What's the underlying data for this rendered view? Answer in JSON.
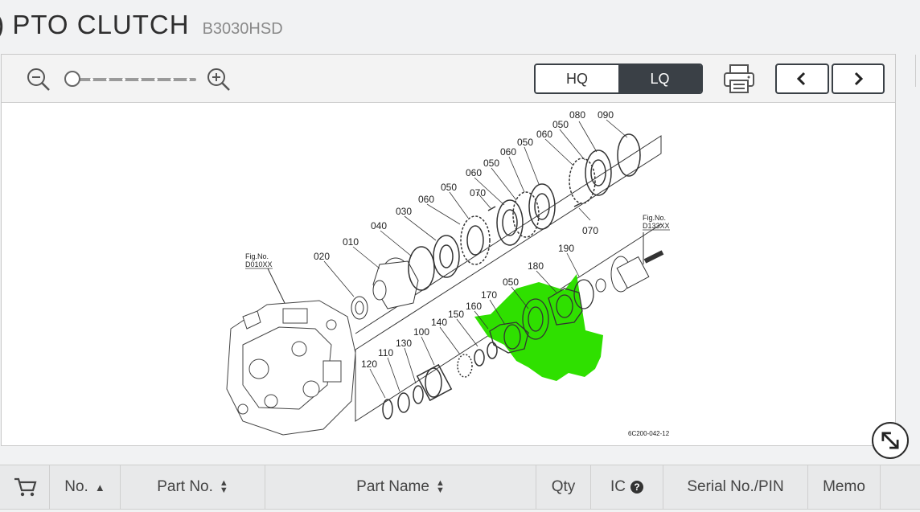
{
  "header": {
    "back_glyph": ")",
    "title": "PTO CLUTCH",
    "model": "B3030HSD"
  },
  "toolbar": {
    "zoom_out_icon": "zoom-out-icon",
    "zoom_in_icon": "zoom-in-icon",
    "zoom_level_fraction": 0.0,
    "quality_options": [
      "HQ",
      "LQ"
    ],
    "quality_selected": "LQ",
    "print_icon": "printer-icon",
    "prev_icon": "chevron-left-icon",
    "next_icon": "chevron-right-icon"
  },
  "diagram": {
    "fig_left_label": "Fig.No.",
    "fig_left_code": "D010XX",
    "fig_right_label": "Fig.No.",
    "fig_right_code": "D133XX",
    "part_labels": [
      "080",
      "090",
      "050",
      "060",
      "050",
      "060",
      "050",
      "060",
      "070",
      "050",
      "060",
      "030",
      "070",
      "040",
      "010",
      "020",
      "190",
      "180",
      "050",
      "170",
      "160",
      "150",
      "140",
      "100",
      "130",
      "110",
      "120"
    ],
    "drawing_code": "6C200-042-12",
    "highlight_color": "#2fe000"
  },
  "expand_icon": "expand-arrows-icon",
  "table": {
    "cart_icon": "cart-icon",
    "columns": [
      "No.",
      "Part No.",
      "Part Name",
      "Qty",
      "IC",
      "Serial No./PIN",
      "Memo"
    ]
  }
}
